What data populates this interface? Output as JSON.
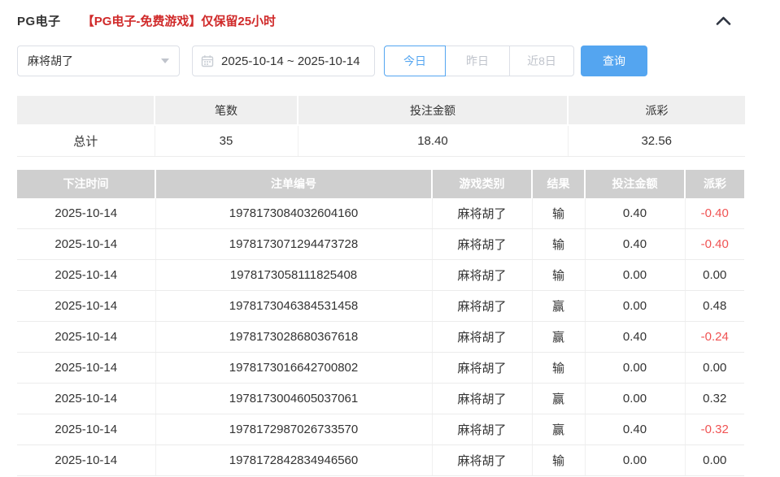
{
  "header": {
    "title": "PG电子",
    "notice": "【PG电子-免费游戏】仅保留25小时",
    "collapse_icon": "chevron-up-icon"
  },
  "filters": {
    "game_select": {
      "value": "麻将胡了",
      "icon": "caret-down-icon"
    },
    "date_range": {
      "value": "2025-10-14 ~ 2025-10-14",
      "icon": "calendar-icon"
    },
    "quick_buttons": [
      {
        "label": "今日",
        "active": true
      },
      {
        "label": "昨日",
        "active": false
      },
      {
        "label": "近8日",
        "active": false
      }
    ],
    "search_label": "查询"
  },
  "summary_table": {
    "columns": [
      "",
      "笔数",
      "投注金额",
      "派彩"
    ],
    "row": {
      "label": "总计",
      "count": "35",
      "bet_amount": "18.40",
      "payout": "32.56"
    }
  },
  "records_table": {
    "columns": [
      "下注时间",
      "注单编号",
      "游戏类别",
      "结果",
      "投注金额",
      "派彩"
    ],
    "rows": [
      {
        "date": "2025-10-14",
        "order_no": "1978173084032604160",
        "game": "麻将胡了",
        "result": "输",
        "bet": "0.40",
        "payout": "-0.40"
      },
      {
        "date": "2025-10-14",
        "order_no": "1978173071294473728",
        "game": "麻将胡了",
        "result": "输",
        "bet": "0.40",
        "payout": "-0.40"
      },
      {
        "date": "2025-10-14",
        "order_no": "1978173058111825408",
        "game": "麻将胡了",
        "result": "输",
        "bet": "0.00",
        "payout": "0.00"
      },
      {
        "date": "2025-10-14",
        "order_no": "1978173046384531458",
        "game": "麻将胡了",
        "result": "赢",
        "bet": "0.00",
        "payout": "0.48"
      },
      {
        "date": "2025-10-14",
        "order_no": "1978173028680367618",
        "game": "麻将胡了",
        "result": "赢",
        "bet": "0.40",
        "payout": "-0.24"
      },
      {
        "date": "2025-10-14",
        "order_no": "1978173016642700802",
        "game": "麻将胡了",
        "result": "输",
        "bet": "0.00",
        "payout": "0.00"
      },
      {
        "date": "2025-10-14",
        "order_no": "1978173004605037061",
        "game": "麻将胡了",
        "result": "赢",
        "bet": "0.00",
        "payout": "0.32"
      },
      {
        "date": "2025-10-14",
        "order_no": "1978172987026733570",
        "game": "麻将胡了",
        "result": "赢",
        "bet": "0.40",
        "payout": "-0.32"
      },
      {
        "date": "2025-10-14",
        "order_no": "1978172842834946560",
        "game": "麻将胡了",
        "result": "输",
        "bet": "0.00",
        "payout": "0.00"
      }
    ]
  },
  "colors": {
    "accent_blue": "#54a5f0",
    "negative_red": "#f05353",
    "notice_red": "#d02a2a",
    "records_header_bg": "#cfcfcf",
    "summary_header_bg": "#efefef"
  }
}
